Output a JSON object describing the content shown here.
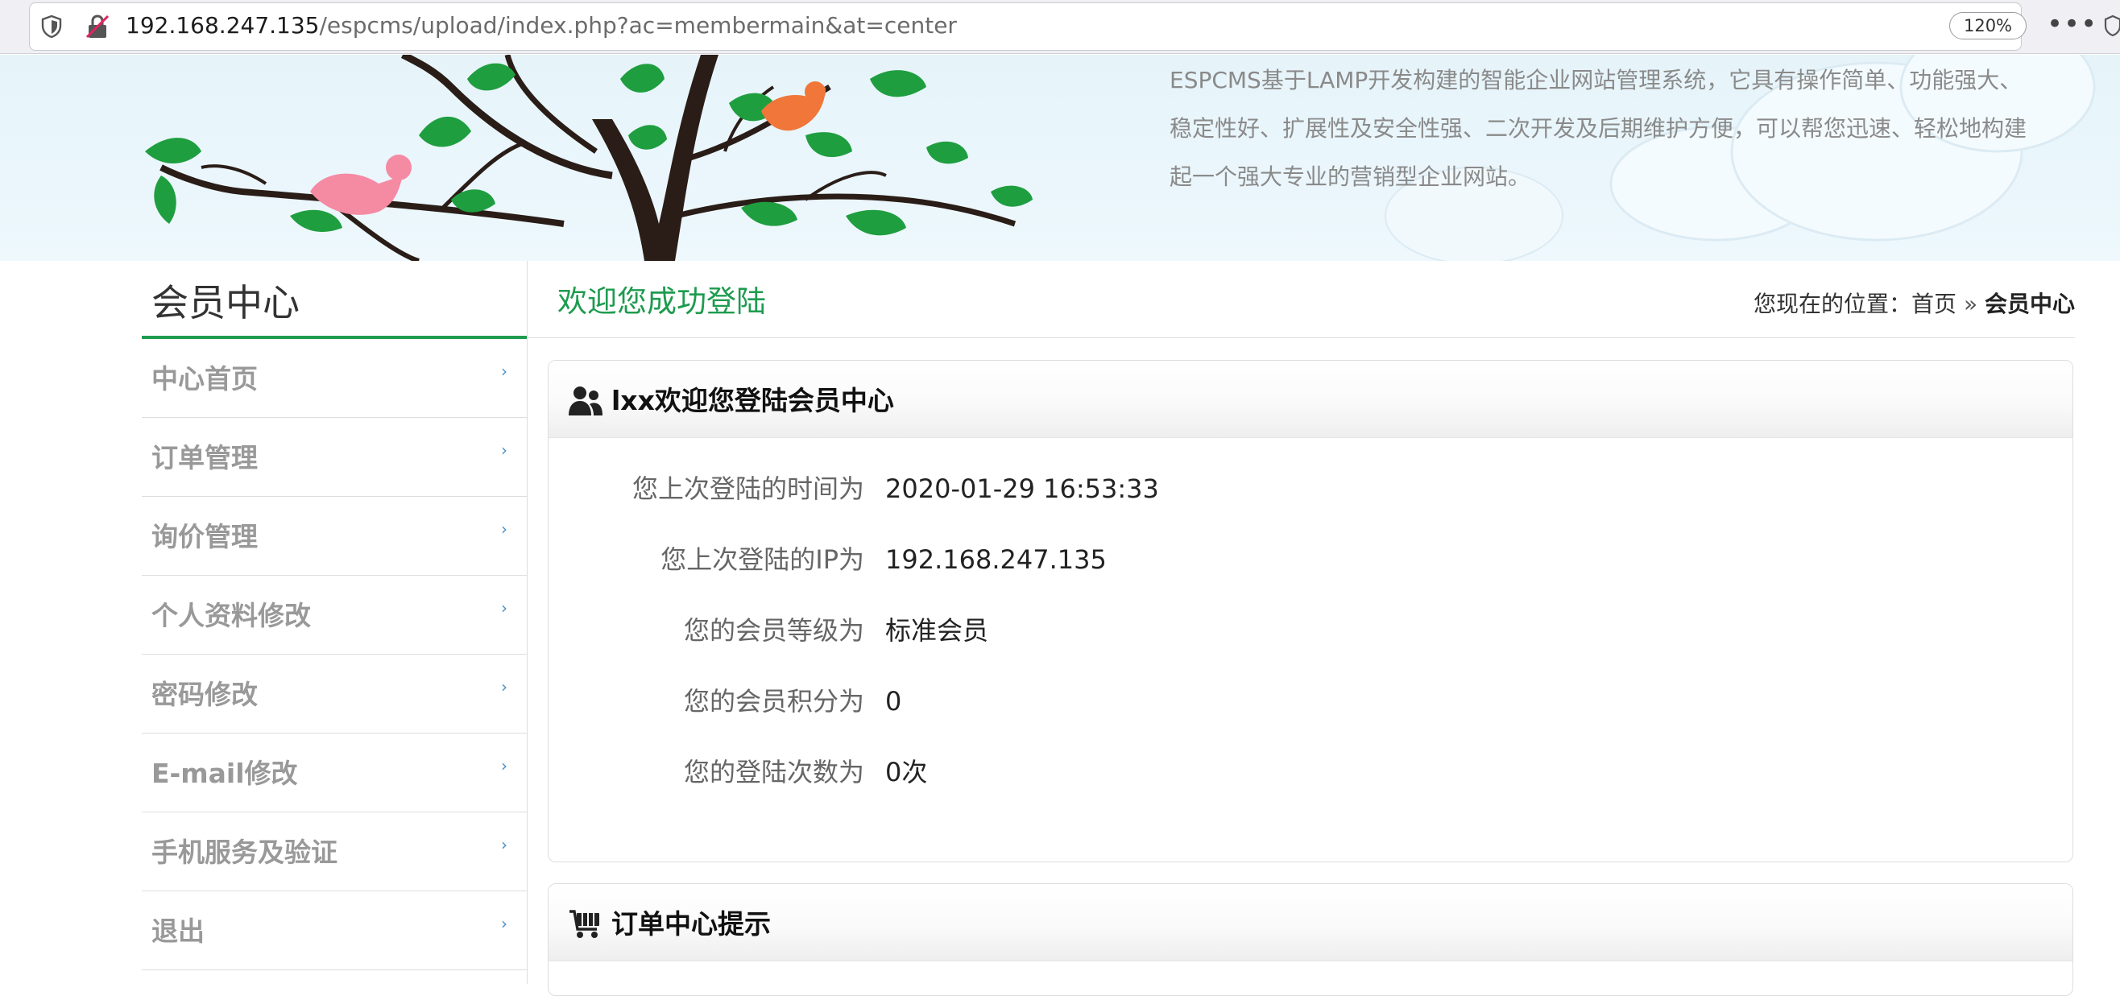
{
  "browser": {
    "url_host": "192.168.247.135",
    "url_path": "/espcms/upload/index.php?ac=membermain&at=center",
    "zoom": "120%",
    "more": "•••"
  },
  "banner": {
    "description": "ESPCMS基于LAMP开发构建的智能企业网站管理系统，它具有操作简单、功能强大、稳定性好、扩展性及安全性强、二次开发及后期维护方便，可以帮您迅速、轻松地构建起一个强大专业的营销型企业网站。"
  },
  "sidebar": {
    "title": "会员中心",
    "items": [
      {
        "label": "中心首页"
      },
      {
        "label": "订单管理"
      },
      {
        "label": "询价管理"
      },
      {
        "label": "个人资料修改"
      },
      {
        "label": "密码修改"
      },
      {
        "label": "E-mail修改"
      },
      {
        "label": "手机服务及验证"
      },
      {
        "label": "退出"
      }
    ],
    "chevron": "›"
  },
  "main": {
    "heading": "欢迎您成功登陆",
    "breadcrumb": {
      "prefix": "您现在的位置：",
      "home": "首页",
      "separator": "»",
      "current": "会员中心"
    },
    "login_panel": {
      "title": "lxx欢迎您登陆会员中心",
      "icon": "users-icon",
      "rows": [
        {
          "label": "您上次登陆的时间为",
          "value": "2020-01-29 16:53:33"
        },
        {
          "label": "您上次登陆的IP为",
          "value": "192.168.247.135"
        },
        {
          "label": "您的会员等级为",
          "value": "标准会员"
        },
        {
          "label": "您的会员积分为",
          "value": "0"
        },
        {
          "label": "您的登陆次数为",
          "value": "0次"
        }
      ]
    },
    "orders_panel": {
      "title": "订单中心提示",
      "icon": "cart-icon"
    }
  },
  "colors": {
    "accent_green": "#1e9b4f",
    "banner_bg": "#e6f4fa",
    "muted_text": "#999999"
  }
}
